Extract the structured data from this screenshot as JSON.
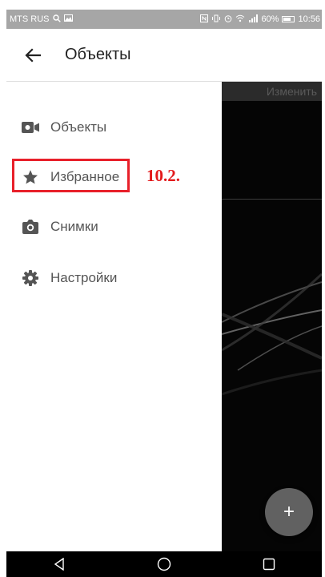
{
  "status_bar": {
    "carrier": "MTS RUS",
    "battery": "60%",
    "time": "10:56"
  },
  "app_bar": {
    "title": "Объекты",
    "back_icon": "arrow-left-icon"
  },
  "content": {
    "edit_label": "Изменить",
    "fab_label": "+"
  },
  "drawer": {
    "items": [
      {
        "label": "Объекты",
        "icon": "video-camera-icon"
      },
      {
        "label": "Избранное",
        "icon": "star-icon"
      },
      {
        "label": "Снимки",
        "icon": "photo-camera-icon"
      },
      {
        "label": "Настройки",
        "icon": "gear-icon"
      }
    ]
  },
  "annotation": {
    "text": "10.2.",
    "color": "#e31a1c"
  },
  "nav_bar": {
    "buttons": [
      "back-triangle-icon",
      "home-circle-icon",
      "recents-square-icon"
    ]
  }
}
